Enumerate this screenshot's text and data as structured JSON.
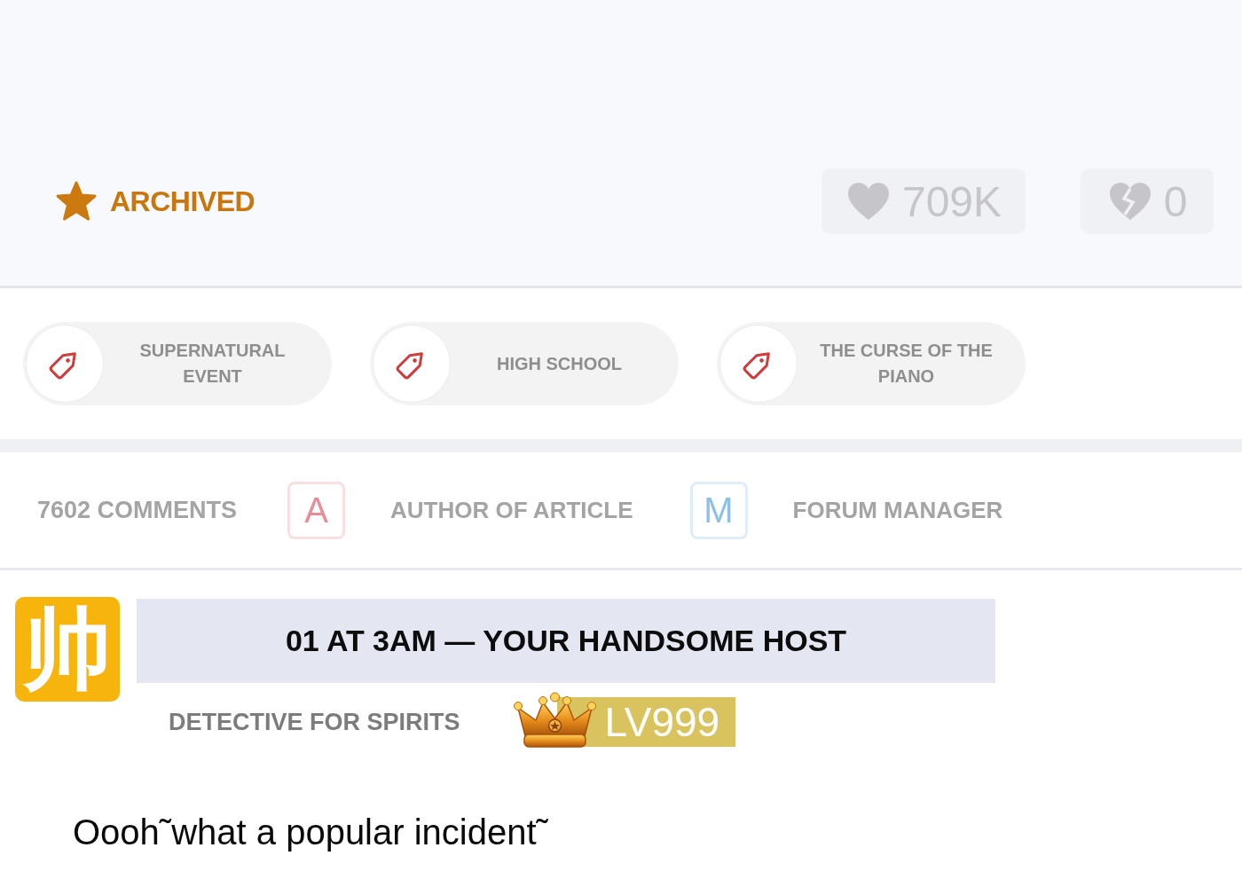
{
  "header": {
    "status": {
      "label": "ARCHIVED"
    },
    "reactions": [
      {
        "kind": "like",
        "count": "709K"
      },
      {
        "kind": "dislike",
        "count": "0"
      }
    ]
  },
  "tags": [
    {
      "label": "SUPERNATURAL EVENT"
    },
    {
      "label": "HIGH SCHOOL"
    },
    {
      "label": "THE CURSE OF THE PIANO"
    }
  ],
  "comments_bar": {
    "count": "7602 COMMENTS",
    "legend": [
      {
        "badge": "A",
        "label": "AUTHOR OF ARTICLE",
        "color": "#e88d96"
      },
      {
        "badge": "M",
        "label": "FORUM MANAGER",
        "color": "#8cc0e6"
      }
    ]
  },
  "comment": {
    "avatar": "帅",
    "author": "01 AT 3AM — YOUR HANDSOME HOST",
    "title": "DETECTIVE FOR SPIRITS",
    "level": "LV999",
    "text": "Oooh˜what a popular incident˜"
  }
}
